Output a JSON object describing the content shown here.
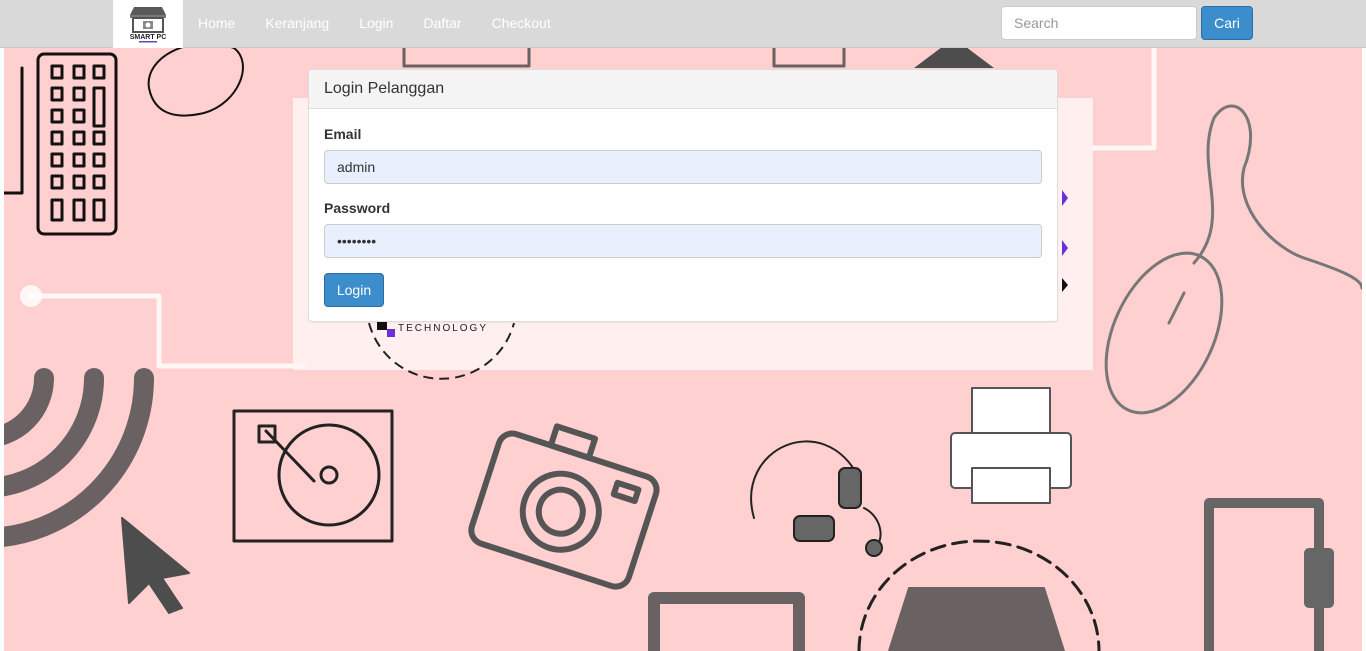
{
  "brand": {
    "logo_text": "SMART PC",
    "logo_subtext": "TECHNOLOGY"
  },
  "nav": {
    "items": [
      {
        "label": "Home"
      },
      {
        "label": "Keranjang"
      },
      {
        "label": "Login"
      },
      {
        "label": "Daftar"
      },
      {
        "label": "Checkout"
      }
    ]
  },
  "search": {
    "placeholder": "Search",
    "button_label": "Cari"
  },
  "login_panel": {
    "title": "Login Pelanggan",
    "email_label": "Email",
    "email_value": "admin",
    "password_label": "Password",
    "password_value": "admin123",
    "submit_label": "Login"
  },
  "background": {
    "banner_text": "TECHNOLOGY"
  },
  "colors": {
    "navbar_bg": "#d9d9d9",
    "page_bg": "#ffd0cf",
    "primary_button": "#3c8dcb",
    "input_autofill_bg": "#e8f0fe"
  }
}
